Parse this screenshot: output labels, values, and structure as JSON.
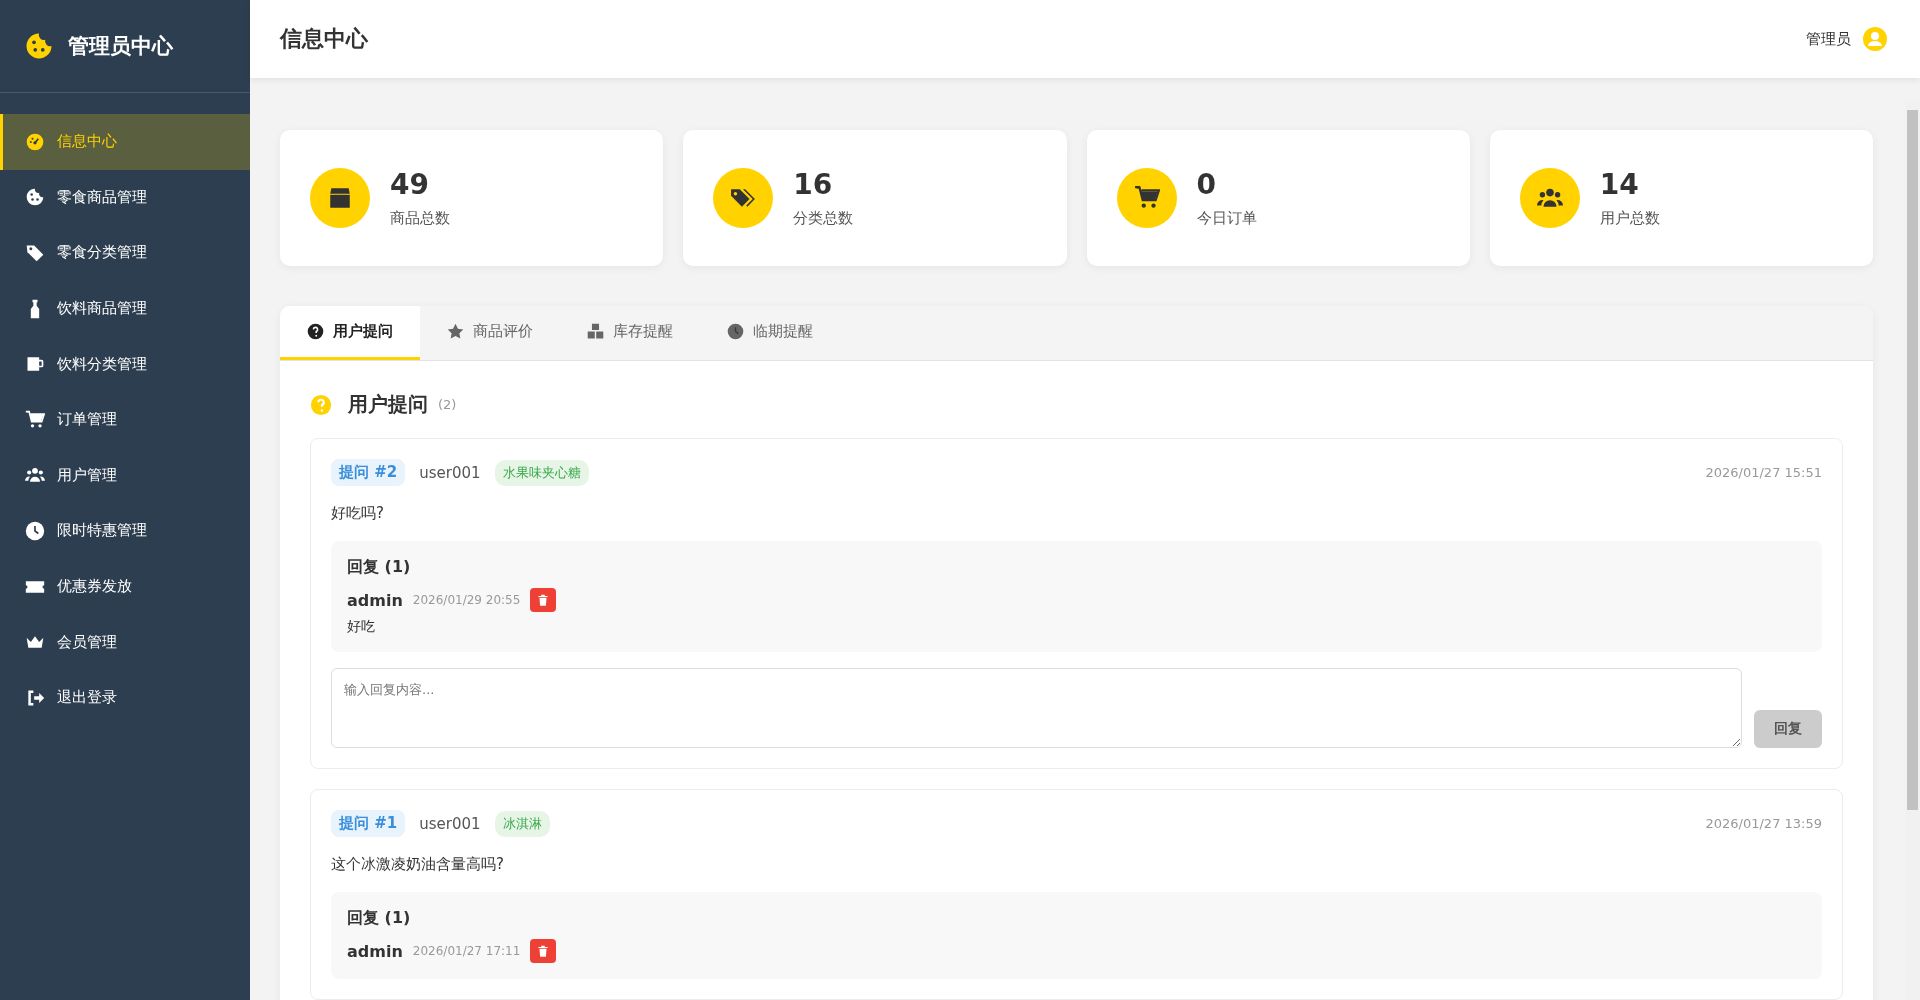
{
  "sidebar": {
    "title": "管理员中心",
    "items": [
      {
        "label": "信息中心",
        "selected": true
      },
      {
        "label": "零食商品管理",
        "selected": false
      },
      {
        "label": "零食分类管理",
        "selected": false
      },
      {
        "label": "饮料商品管理",
        "selected": false
      },
      {
        "label": "饮料分类管理",
        "selected": false
      },
      {
        "label": "订单管理",
        "selected": false
      },
      {
        "label": "用户管理",
        "selected": false
      },
      {
        "label": "限时特惠管理",
        "selected": false
      },
      {
        "label": "优惠券发放",
        "selected": false
      },
      {
        "label": "会员管理",
        "selected": false
      },
      {
        "label": "退出登录",
        "selected": false
      }
    ]
  },
  "header": {
    "title": "信息中心",
    "user": "管理员"
  },
  "stats": [
    {
      "value": "49",
      "label": "商品总数"
    },
    {
      "value": "16",
      "label": "分类总数"
    },
    {
      "value": "0",
      "label": "今日订单"
    },
    {
      "value": "14",
      "label": "用户总数"
    }
  ],
  "tabs": [
    {
      "label": "用户提问",
      "selected": true
    },
    {
      "label": "商品评价",
      "selected": false
    },
    {
      "label": "库存提醒",
      "selected": false
    },
    {
      "label": "临期提醒",
      "selected": false
    }
  ],
  "section": {
    "title": "用户提问",
    "count": "(2)"
  },
  "questions": [
    {
      "badge": "提问 #2",
      "user": "user001",
      "product": "水果味夹心糖",
      "time": "2026/01/27 15:51",
      "text": "好吃吗?",
      "replies_title": "回复 (1)",
      "replies": [
        {
          "author": "admin",
          "time": "2026/01/29 20:55",
          "text": "好吃"
        }
      ],
      "placeholder": "输入回复内容...",
      "button": {
        "label": "回复",
        "disabled": true
      }
    },
    {
      "badge": "提问 #1",
      "user": "user001",
      "product": "冰淇淋",
      "time": "2026/01/27 13:59",
      "text": "这个冰激凌奶油含量高吗?",
      "replies_title": "回复 (1)",
      "replies": [
        {
          "author": "admin",
          "time": "2026/01/27 17:11"
        }
      ]
    }
  ]
}
